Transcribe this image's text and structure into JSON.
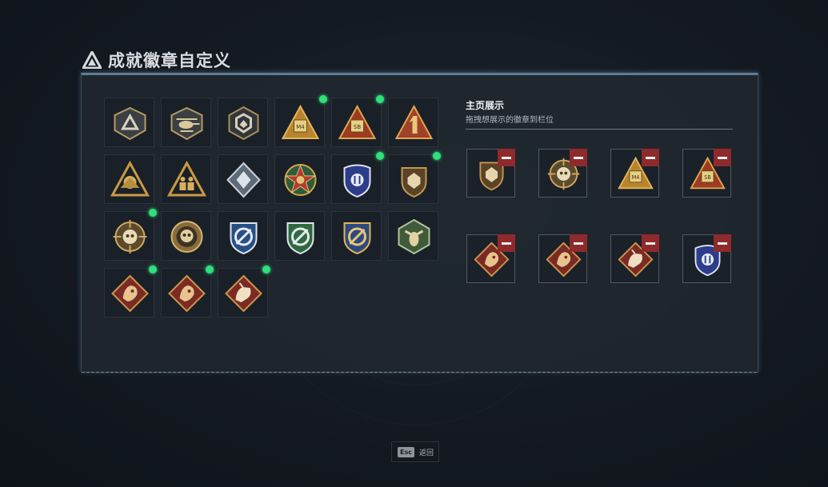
{
  "page": {
    "title": "成就徽章自定义"
  },
  "collection": {
    "badges": [
      {
        "icon": "triangle-insignia-icon",
        "new": false
      },
      {
        "icon": "helicopter-insignia-icon",
        "new": false
      },
      {
        "icon": "hexagon-emblem-icon",
        "new": false
      },
      {
        "icon": "gold-triangle-m4-icon",
        "new": true
      },
      {
        "icon": "red-triangle-sb-icon",
        "new": true
      },
      {
        "icon": "triangle-number-one-icon",
        "new": false
      },
      {
        "icon": "gold-triangle-crest-icon",
        "new": false
      },
      {
        "icon": "gold-triangle-soldiers-icon",
        "new": false
      },
      {
        "icon": "silver-diamond-icon",
        "new": false
      },
      {
        "icon": "red-star-medal-icon",
        "new": false
      },
      {
        "icon": "police-shield-icon",
        "new": true
      },
      {
        "icon": "bronze-shield-icon",
        "new": true
      },
      {
        "icon": "skull-crosshair-icon",
        "new": true
      },
      {
        "icon": "gold-skull-medal-icon",
        "new": false
      },
      {
        "icon": "blue-wrench-shield-icon",
        "new": false
      },
      {
        "icon": "green-wrench-shield-icon",
        "new": false
      },
      {
        "icon": "gold-wrench-shield-icon",
        "new": false
      },
      {
        "icon": "green-hex-wasp-icon",
        "new": false
      },
      {
        "icon": "red-dragon-diamond-icon",
        "new": true
      },
      {
        "icon": "red-dragon-diamond-icon",
        "new": true
      },
      {
        "icon": "red-beast-diamond-icon",
        "new": true
      }
    ]
  },
  "showcase": {
    "title": "主页展示",
    "subtitle": "拖拽想展示的徽章到栏位",
    "slots": [
      {
        "icon": "bronze-shield-icon"
      },
      {
        "icon": "skull-crosshair-icon"
      },
      {
        "icon": "gold-triangle-m4-icon"
      },
      {
        "icon": "red-triangle-sb-icon"
      },
      {
        "icon": "red-dragon-diamond-icon"
      },
      {
        "icon": "red-dragon-diamond-icon"
      },
      {
        "icon": "red-beast-diamond-icon"
      },
      {
        "icon": "police-shield-icon"
      }
    ]
  },
  "footer": {
    "esc_key": "Esc",
    "back_label": "返回"
  }
}
